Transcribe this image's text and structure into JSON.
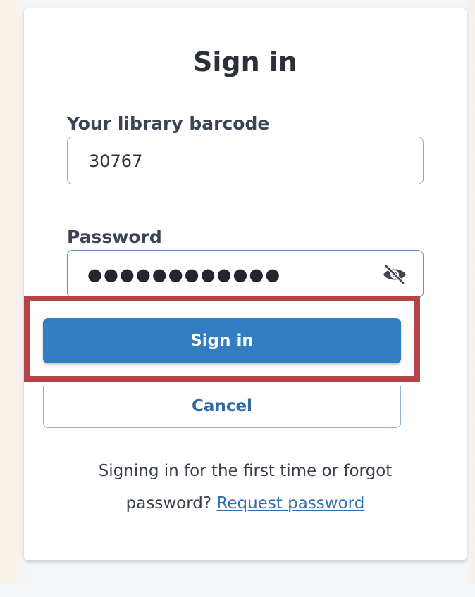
{
  "page": {
    "title": "Sign in"
  },
  "form": {
    "barcode_label": "Your library barcode",
    "barcode_value": "30767",
    "password_label": "Password",
    "password_mask": "●●●●●●●●●●●●",
    "toggle_icon": "eye-slash-icon"
  },
  "actions": {
    "signin_label": "Sign in",
    "cancel_label": "Cancel"
  },
  "help": {
    "text_line1": "Signing in for the first time or forgot",
    "text_line2": "password?",
    "link": "Request password"
  },
  "colors": {
    "primary": "#337ec2",
    "highlight_border": "#b54548",
    "link": "#2f6fb5"
  }
}
